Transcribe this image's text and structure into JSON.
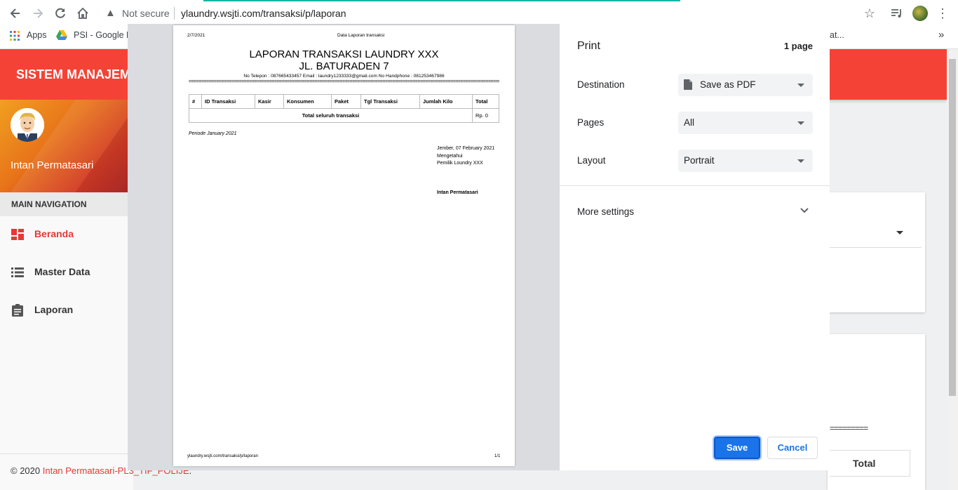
{
  "browser": {
    "not_secure": "Not secure",
    "url": "ylaundry.wsjti.com/transaksi/p/laporan",
    "bookmarks": [
      "Apps",
      "PSI - Google D",
      "at..."
    ],
    "more_bookmarks": "»"
  },
  "app": {
    "title": "SISTEM MANAJEMEN",
    "user_name": "Intan Permatasari",
    "main_nav_label": "MAIN NAVIGATION",
    "nav": [
      {
        "label": "Beranda",
        "active": true
      },
      {
        "label": "Master Data",
        "active": false
      },
      {
        "label": "Laporan",
        "active": false
      }
    ],
    "footer_prefix": "© 2020 ",
    "footer_link": "Intan Permatasari-PL3_TIF_POLIJE",
    "footer_suffix": ".",
    "bg_total": "Total",
    "bg_eq": "========="
  },
  "preview": {
    "date": "2/7/2021",
    "header_title": "Data Laporan transaksi",
    "title1": "LAPORAN TRANSAKSI LAUNDRY XXX",
    "title2": "JL. BATURADEN 7",
    "info": "No Telepon : 087665433457 Email : laundry1233333@gmail.com No Handphone : 081253467986",
    "separator": "=========================================================================================================================================",
    "columns": [
      "#",
      "ID Transaksi",
      "Kasir",
      "Konsumen",
      "Paket",
      "Tgl Transaksi",
      "Jumlah Kilo",
      "Total"
    ],
    "total_label": "Total seluruh transaksi",
    "total_value": "Rp. 0",
    "period": "Periode January 2021",
    "sign_date": "Jember, 07 February 2021",
    "sign_known": "Mengetahui",
    "sign_owner": "Pemilik Loundry XXX",
    "sign_name": "Intan Permatasari",
    "footer_url": "ylaundry.wsjti.com/transaksi/p/laporan",
    "footer_page": "1/1"
  },
  "print": {
    "title": "Print",
    "page_count": "1 page",
    "destination_label": "Destination",
    "destination_value": "Save as PDF",
    "pages_label": "Pages",
    "pages_value": "All",
    "layout_label": "Layout",
    "layout_value": "Portrait",
    "more_settings": "More settings",
    "save": "Save",
    "cancel": "Cancel"
  }
}
